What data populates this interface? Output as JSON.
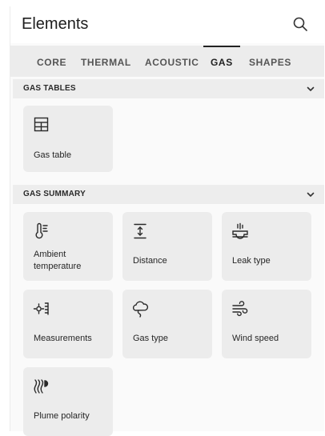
{
  "header": {
    "title": "Elements",
    "search_icon": "search-icon"
  },
  "tabs": [
    {
      "label": "CORE",
      "active": false
    },
    {
      "label": "THERMAL",
      "active": false
    },
    {
      "label": "ACOUSTIC",
      "active": false
    },
    {
      "label": "GAS",
      "active": true
    },
    {
      "label": "SHAPES",
      "active": false
    }
  ],
  "sections": {
    "gas_tables": {
      "label": "GAS TABLES",
      "expanded": true,
      "items": [
        {
          "label": "Gas table",
          "icon": "table-icon"
        }
      ]
    },
    "gas_summary": {
      "label": "GAS SUMMARY",
      "expanded": true,
      "items": [
        {
          "label": "Ambient temperature",
          "icon": "thermometer-icon"
        },
        {
          "label": "Distance",
          "icon": "distance-icon"
        },
        {
          "label": "Leak type",
          "icon": "leak-icon"
        },
        {
          "label": "Measurements",
          "icon": "measurements-icon"
        },
        {
          "label": "Gas type",
          "icon": "gas-cloud-icon"
        },
        {
          "label": "Wind speed",
          "icon": "wind-icon"
        },
        {
          "label": "Plume polarity",
          "icon": "plume-icon"
        }
      ]
    }
  }
}
